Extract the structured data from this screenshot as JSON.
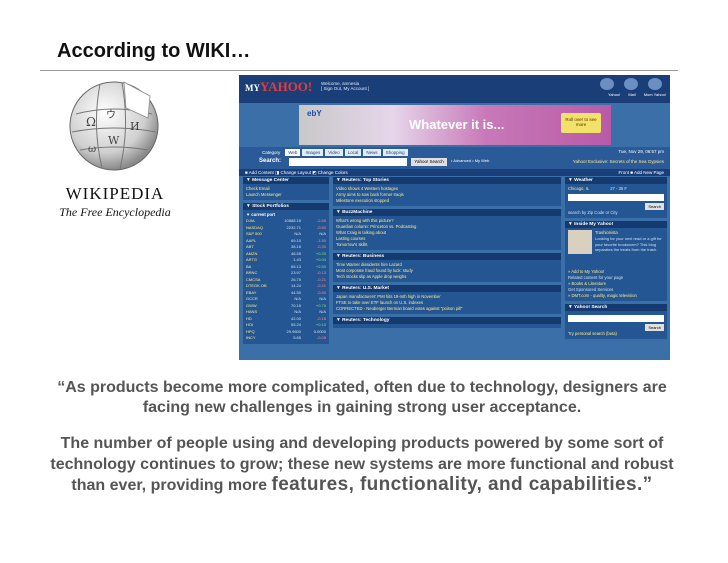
{
  "slide": {
    "title": "According to WIKI…"
  },
  "logo": {
    "word": "WIKIPEDIA",
    "tagline": "The Free Encyclopedia"
  },
  "screenshot": {
    "header": {
      "logo_my": "MY",
      "logo_yahoo": "YAHOO!",
      "welcome": "Welcome, amnesia",
      "welcome_links": "[ Sign Out, My Account ]",
      "icons": [
        "Yahoo!",
        "Mail",
        "Mom Yahoo!"
      ]
    },
    "banner": {
      "ebay": "ebY",
      "headline": "Whatever it is...",
      "rollover": "Roll over to see more"
    },
    "search": {
      "tabs": [
        "Web",
        "Images",
        "Video",
        "Local",
        "News",
        "Shopping"
      ],
      "category_label": "Category",
      "label": "Search:",
      "button": "Yahoo! Search",
      "advanced": "• Advanced • My Web",
      "date": "Tue, Nov 29, 06:57 pm",
      "exclusive": "Yahoo! Exclusive: Secrets of the Sea Gypsies"
    },
    "toolbar": {
      "left": "■ Add Content  ◨ Change Layout  ◩ Change Colors",
      "right": "Front   ■ Add New Page"
    },
    "left_col": {
      "message_title": "▼ Message Center",
      "message_links": [
        "Check Email",
        "Launch Messenger"
      ],
      "stocks_title": "▼ Stock Portfolios",
      "portfolio": "▼ current port",
      "stocks": [
        {
          "tk": "DJIA",
          "v": "10888.16",
          "c": "-2.65",
          "dir": "dn"
        },
        {
          "tk": "NASDAQ",
          "v": "2232.71",
          "c": "-0.50",
          "dir": "dn"
        },
        {
          "tk": "S&P 500",
          "v": "N/A",
          "c": "N/A",
          "dir": ""
        },
        {
          "tk": "AAPL",
          "v": "69.10",
          "c": "-1.50",
          "dir": "dn"
        },
        {
          "tk": "ABT",
          "v": "38.18",
          "c": "-0.30",
          "dir": "dn"
        },
        {
          "tk": "AMZN",
          "v": "46.55",
          "c": "+0.20",
          "dir": "up"
        },
        {
          "tk": "ARTG",
          "v": "1.43",
          "c": "+0.04",
          "dir": "up"
        },
        {
          "tk": "BA",
          "v": "65.13",
          "c": "+2.50",
          "dir": "up"
        },
        {
          "tk": "BRNC",
          "v": "23.97",
          "c": "-0.13",
          "dir": "dn"
        },
        {
          "tk": "CMCSA",
          "v": "26.75",
          "c": "-0.21",
          "dir": "dn"
        },
        {
          "tk": "DTEGK.OB",
          "v": "14.24",
          "c": "-0.21",
          "dir": "dn"
        },
        {
          "tk": "EBAY",
          "v": "44.50",
          "c": "-0.50",
          "dir": "dn"
        },
        {
          "tk": "GCCR",
          "v": "N/A",
          "c": "N/A",
          "dir": ""
        },
        {
          "tk": "GWW",
          "v": "70.15",
          "c": "+0.75",
          "dir": "up"
        },
        {
          "tk": "HANS",
          "v": "N/A",
          "c": "N/A",
          "dir": ""
        },
        {
          "tk": "HD",
          "v": "42.00",
          "c": "-0.18",
          "dir": "dn"
        },
        {
          "tk": "HOI",
          "v": "55.24",
          "c": "+0.10",
          "dir": "up"
        },
        {
          "tk": "HPQ",
          "v": "29.9600",
          "c": "0.0000",
          "dir": ""
        },
        {
          "tk": "INCY",
          "v": "5.65",
          "c": "-0.05",
          "dir": "dn"
        }
      ]
    },
    "mid_col": {
      "modules": [
        {
          "title": "▼ Reuters: Top Stories",
          "items": [
            "Video shows 4 Western hostages",
            "Army aims to sow back former Iraqis",
            "Milestone execution stopped"
          ]
        },
        {
          "title": "▼ BuzzMachine",
          "items": [
            "What's wrong with this picture?",
            "Guardian column: Princeton vs. Podcasting",
            "What Craig is talking about",
            "Lasting courses",
            "Tomorrow's skills"
          ]
        },
        {
          "title": "▼ Reuters: Business",
          "items": [
            "Time Warner dissidents hire Lazard",
            "Most corporate fraud found by luck: study",
            "Tech stocks slip as Apple drop weighs"
          ]
        },
        {
          "title": "▼ Reuters: U.S. Market",
          "items": [
            "Japan manufacturers' PMI hits 19-mth high in November",
            "FTSE to take over ETF launch on U.S. indexes",
            "CORRECTED - Neuberger Berman board votes against \"poison pill\""
          ]
        },
        {
          "title": "▼ Reuters: Technology",
          "items": []
        }
      ]
    },
    "right_col": {
      "weather_title": "▼ Weather",
      "weather_city": "Chicago, IL",
      "weather_temp": "27 - 35 F",
      "weather_btn": "Search",
      "weather_hint": "search by Zip Code or City",
      "inside_title": "▼ Inside My Yahoo!",
      "inside_name": "Trashionista",
      "inside_text": "Looking for your next read or a gift for your favorite bookworm? This blog separates the treats from the trash.",
      "inside_link": "» Add to My Yahoo!",
      "inside_related": "Related content for your page",
      "inside_books": "» Books & Literature",
      "inside_sponsor": "Get Sponsored Services",
      "inside_sponsor_link": "» DMT.com - quality, magic television",
      "ysearch_title": "▼ Yahoo! Search",
      "ysearch_btn": "Search",
      "ysearch_link": "Try personal search (beta)"
    }
  },
  "quote": {
    "line1": "“As products become more complicated, often due to technology, designers are",
    "line2": "facing new challenges in gaining strong user acceptance.",
    "line3": "The number of people using and developing products powered by some sort of",
    "line4": "technology continues to grow; these new systems are more functional and robust",
    "line5a": "than ever, providing more ",
    "line5b": "features, functionality, and capabilities.”"
  }
}
